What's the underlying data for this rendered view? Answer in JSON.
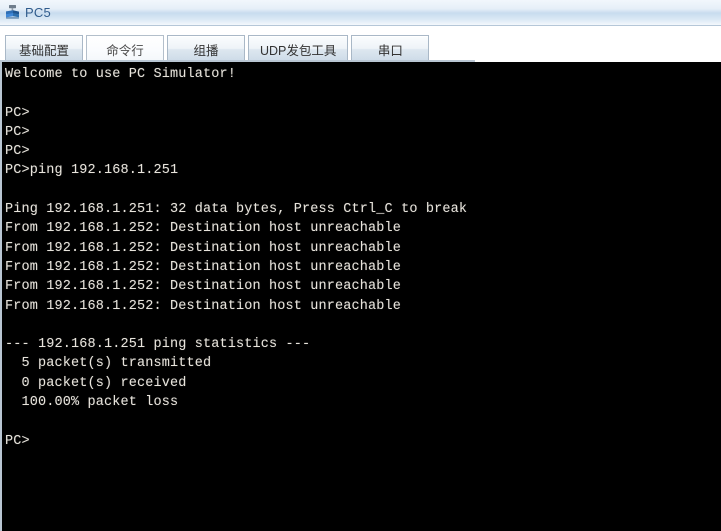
{
  "window": {
    "title": "PC5",
    "icon": "pc-device-icon"
  },
  "tabs": [
    {
      "label": "基础配置",
      "name": "tab-basic-config",
      "active": false
    },
    {
      "label": "命令行",
      "name": "tab-command-line",
      "active": true
    },
    {
      "label": "组播",
      "name": "tab-multicast",
      "active": false
    },
    {
      "label": "UDP发包工具",
      "name": "tab-udp-tool",
      "active": false
    },
    {
      "label": "串口",
      "name": "tab-serial-port",
      "active": false
    }
  ],
  "terminal": {
    "lines": [
      "Welcome to use PC Simulator!",
      "",
      "PC>",
      "PC>",
      "PC>",
      "PC>ping 192.168.1.251",
      "",
      "Ping 192.168.1.251: 32 data bytes, Press Ctrl_C to break",
      "From 192.168.1.252: Destination host unreachable",
      "From 192.168.1.252: Destination host unreachable",
      "From 192.168.1.252: Destination host unreachable",
      "From 192.168.1.252: Destination host unreachable",
      "From 192.168.1.252: Destination host unreachable",
      "",
      "--- 192.168.1.251 ping statistics ---",
      "  5 packet(s) transmitted",
      "  0 packet(s) received",
      "  100.00% packet loss",
      "",
      "PC>"
    ],
    "command": "ping 192.168.1.251",
    "prompt": "PC>",
    "target_host": "192.168.1.251",
    "responding_host": "192.168.1.252",
    "data_bytes": "32",
    "packets_transmitted": "5",
    "packets_received": "0",
    "packet_loss": "100.00%",
    "text_color": "#e8e4dc",
    "background_color": "#000000"
  }
}
